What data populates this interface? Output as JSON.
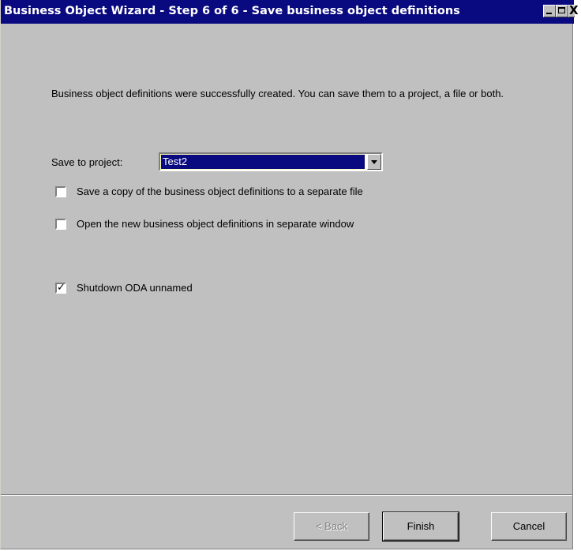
{
  "window": {
    "title": "Business Object Wizard - Step 6 of 6 - Save business object definitions",
    "controls": {
      "minimize_icon": "minimize-icon",
      "maximize_icon": "maximize-icon",
      "close_symbol": "X"
    }
  },
  "content": {
    "description": "Business object definitions were successfully created. You can save them to a project, a file or both.",
    "save_to_project_label": "Save to project:",
    "project_selected": "Test2",
    "options": [
      {
        "label": "Save a copy of the business object definitions to a separate file",
        "checked": false
      },
      {
        "label": "Open the new business object definitions in separate window",
        "checked": false
      },
      {
        "label": "Shutdown ODA unnamed",
        "checked": true
      }
    ]
  },
  "buttons": {
    "back": "< Back",
    "finish": "Finish",
    "cancel": "Cancel"
  },
  "colors": {
    "titlebar": "#0a0a80",
    "dialog_bg": "#c0c0c0",
    "selection": "#0a0a80"
  }
}
